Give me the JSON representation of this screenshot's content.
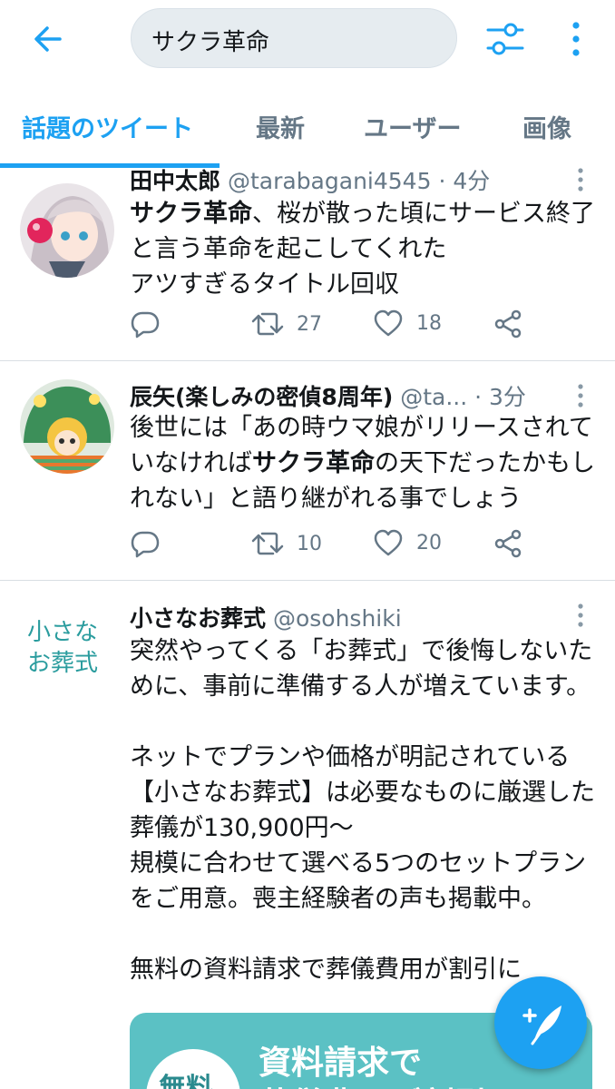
{
  "search": {
    "query": "サクラ革命"
  },
  "tabs": [
    {
      "label": "話題のツイート",
      "active": true
    },
    {
      "label": "最新",
      "active": false
    },
    {
      "label": "ユーザー",
      "active": false
    },
    {
      "label": "画像",
      "active": false
    }
  ],
  "colors": {
    "accent": "#1da1f2",
    "text": "#14171a",
    "muted": "#657786",
    "search_bg": "#e6ecf0",
    "ad_teal": "#5bc1c4"
  },
  "tweets": [
    {
      "name": "田中太郎",
      "handle": "@tarabagani4545",
      "time": "· 4分",
      "body_bold": "サクラ革命",
      "body_rest": "、桜が散った頃にサービス終了と言う革命を起こしてくれた\nアツすぎるタイトル回収",
      "retweets": "27",
      "likes": "18",
      "avatar_icon": "anime-girl-avatar"
    },
    {
      "name": "辰矢(楽しみの密偵8周年)",
      "handle": "@ta...",
      "time": "· 3分",
      "body_pre": "後世には「あの時ウマ娘がリリースされていなければ",
      "body_bold": "サクラ革命",
      "body_post": "の天下だったかもしれない」と語り継がれる事でしょう",
      "retweets": "10",
      "likes": "20",
      "avatar_icon": "anime-character-avatar"
    },
    {
      "name": "小さなお葬式",
      "handle": "@osohshiki",
      "body": "突然やってくる「お葬式」で後悔しないために、事前に準備する人が増えています。\n\nネットでプランや価格が明記されている【小さなお葬式】は必要なものに厳選した葬儀が130,900円〜\n規模に合わせて選べる5つのセットプランをご用意。喪主経験者の声も掲載中。\n\n無料の資料請求で葬儀費用が割引に",
      "avatar_text": "小さな\nお葬式",
      "card_badge": "無料",
      "card_title": "資料請求で",
      "card_sub": "葬儀費用が割引に"
    }
  ],
  "icons": {
    "back": "arrow-left-icon",
    "filter": "sliders-icon",
    "more": "more-vertical-icon",
    "reply": "reply-icon",
    "retweet": "retweet-icon",
    "like": "heart-icon",
    "share": "share-icon",
    "compose": "compose-tweet-icon"
  }
}
